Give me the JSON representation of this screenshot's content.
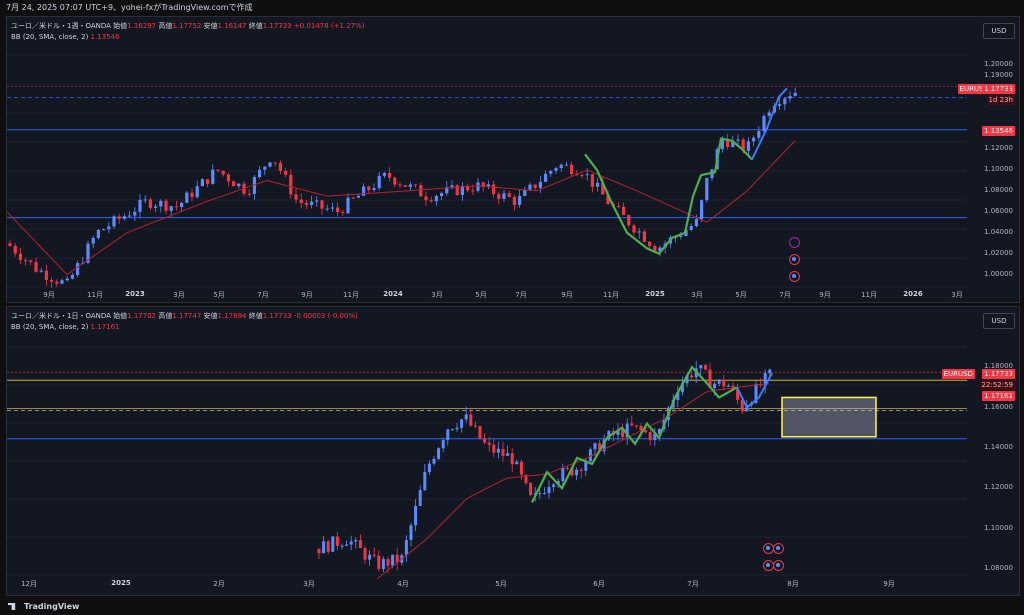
{
  "header": {
    "timestamp": "7月 24, 2025 07:07 UTC+9、yohei-fxがTradingView.comで作成"
  },
  "footer": {
    "brand": "TradingView"
  },
  "pane1": {
    "legend_title": "ユーロ／米ドル・1週・OANDA",
    "ohlc": [
      {
        "k": "始値",
        "v": "1.16297"
      },
      {
        "k": "高値",
        "v": "1.17752"
      },
      {
        "k": "安値",
        "v": "1.16147"
      },
      {
        "k": "終値",
        "v": "1.17733"
      }
    ],
    "change": "+0.01478 (+1.27%)",
    "bb_label": "BB (20, SMA, close, 2)",
    "bb_value": "1.13546",
    "currency": "USD",
    "price_ticks": [
      "1.20000",
      "1.19000",
      "1.12000",
      "1.10000",
      "1.08000",
      "1.06000",
      "1.04000",
      "1.02000",
      "1.00000"
    ],
    "time_ticks": [
      "9月",
      "11月",
      "2023",
      "3月",
      "5月",
      "7月",
      "9月",
      "11月",
      "2024",
      "3月",
      "5月",
      "7月",
      "9月",
      "11月",
      "2025",
      "3月",
      "5月",
      "7月",
      "9月",
      "11月",
      "2026",
      "3月"
    ],
    "symbol_tag": "EURUSD",
    "last_price": "1.17733",
    "countdown": "1d 23h",
    "bb_tag": "1.13546"
  },
  "pane2": {
    "legend_title": "ユーロ／米ドル・1日・OANDA",
    "ohlc": [
      {
        "k": "始値",
        "v": "1.17702"
      },
      {
        "k": "高値",
        "v": "1.17747"
      },
      {
        "k": "安値",
        "v": "1.17694"
      },
      {
        "k": "終値",
        "v": "1.17733"
      }
    ],
    "change": "-0.00003 (-0.00%)",
    "bb_label": "BB (20, SMA, close, 2)",
    "bb_value": "1.17161",
    "currency": "USD",
    "price_ticks": [
      "1.18000",
      "1.16000",
      "1.14000",
      "1.12000",
      "1.10000",
      "1.08000"
    ],
    "time_ticks": [
      "12月",
      "2025",
      "2月",
      "3月",
      "4月",
      "5月",
      "6月",
      "7月",
      "8月",
      "9月"
    ],
    "symbol_tag": "EURUSD",
    "last_price": "1.17733",
    "countdown": "22:52:59",
    "bb_tag": "1.17161"
  },
  "colors": {
    "up": "#5b8cff",
    "down": "#f23645",
    "bb": "#b2242f",
    "hline": "#2962ff",
    "yline": "#c9b037",
    "zone": "#fff44f",
    "wave_green": "#4caf50",
    "wave_blue": "#3d7bff"
  },
  "chart_data": [
    {
      "type": "candlestick",
      "title": "ユーロ／米ドル・1週・OANDA",
      "ylim": [
        0.99,
        1.21
      ],
      "levels": [
        1.1385,
        1.0545
      ],
      "last": 1.17733,
      "ylabel": "USD"
    },
    {
      "type": "candlestick",
      "title": "ユーロ／米ドル・1日・OANDA",
      "ylim": [
        1.075,
        1.19
      ],
      "levels": [
        1.1735,
        1.1585,
        1.1445
      ],
      "zone": {
        "y": [
          1.1455,
          1.165
        ]
      },
      "last": 1.17733,
      "ylabel": "USD"
    }
  ]
}
